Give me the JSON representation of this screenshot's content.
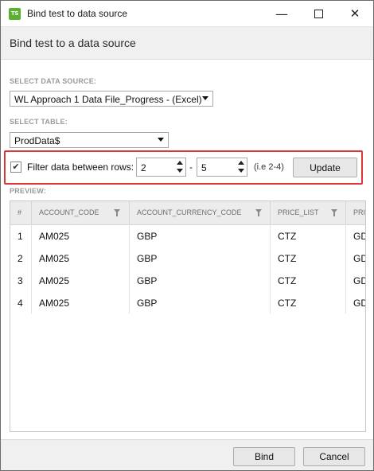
{
  "window": {
    "app_icon_text": "TS",
    "title": "Bind test to data source",
    "minimize_glyph": "—",
    "close_glyph": "✕"
  },
  "header": {
    "title": "Bind test to a data source"
  },
  "data_source": {
    "label": "SELECT DATA SOURCE:",
    "selected": "WL Approach 1 Data File_Progress - (Excel)"
  },
  "table": {
    "label": "SELECT TABLE:",
    "selected": "ProdData$"
  },
  "filter": {
    "checked": true,
    "check_glyph": "✔",
    "label": "Filter data between rows:",
    "from": "2",
    "separator": "-",
    "to": "5",
    "hint": "(i.e 2-4)",
    "update_label": "Update"
  },
  "preview": {
    "label": "PREVIEW:",
    "columns": [
      "#",
      "ACCOUNT_CODE",
      "ACCOUNT_CURRENCY_CODE",
      "PRICE_LIST",
      "PRI"
    ],
    "rows": [
      [
        "1",
        "AM025",
        "GBP",
        "CTZ",
        "GD"
      ],
      [
        "2",
        "AM025",
        "GBP",
        "CTZ",
        "GD"
      ],
      [
        "3",
        "AM025",
        "GBP",
        "CTZ",
        "GD"
      ],
      [
        "4",
        "AM025",
        "GBP",
        "CTZ",
        "GD"
      ]
    ]
  },
  "footer": {
    "bind_label": "Bind",
    "cancel_label": "Cancel"
  },
  "colors": {
    "highlight": "#d9373b",
    "app_icon": "#5ab031"
  }
}
